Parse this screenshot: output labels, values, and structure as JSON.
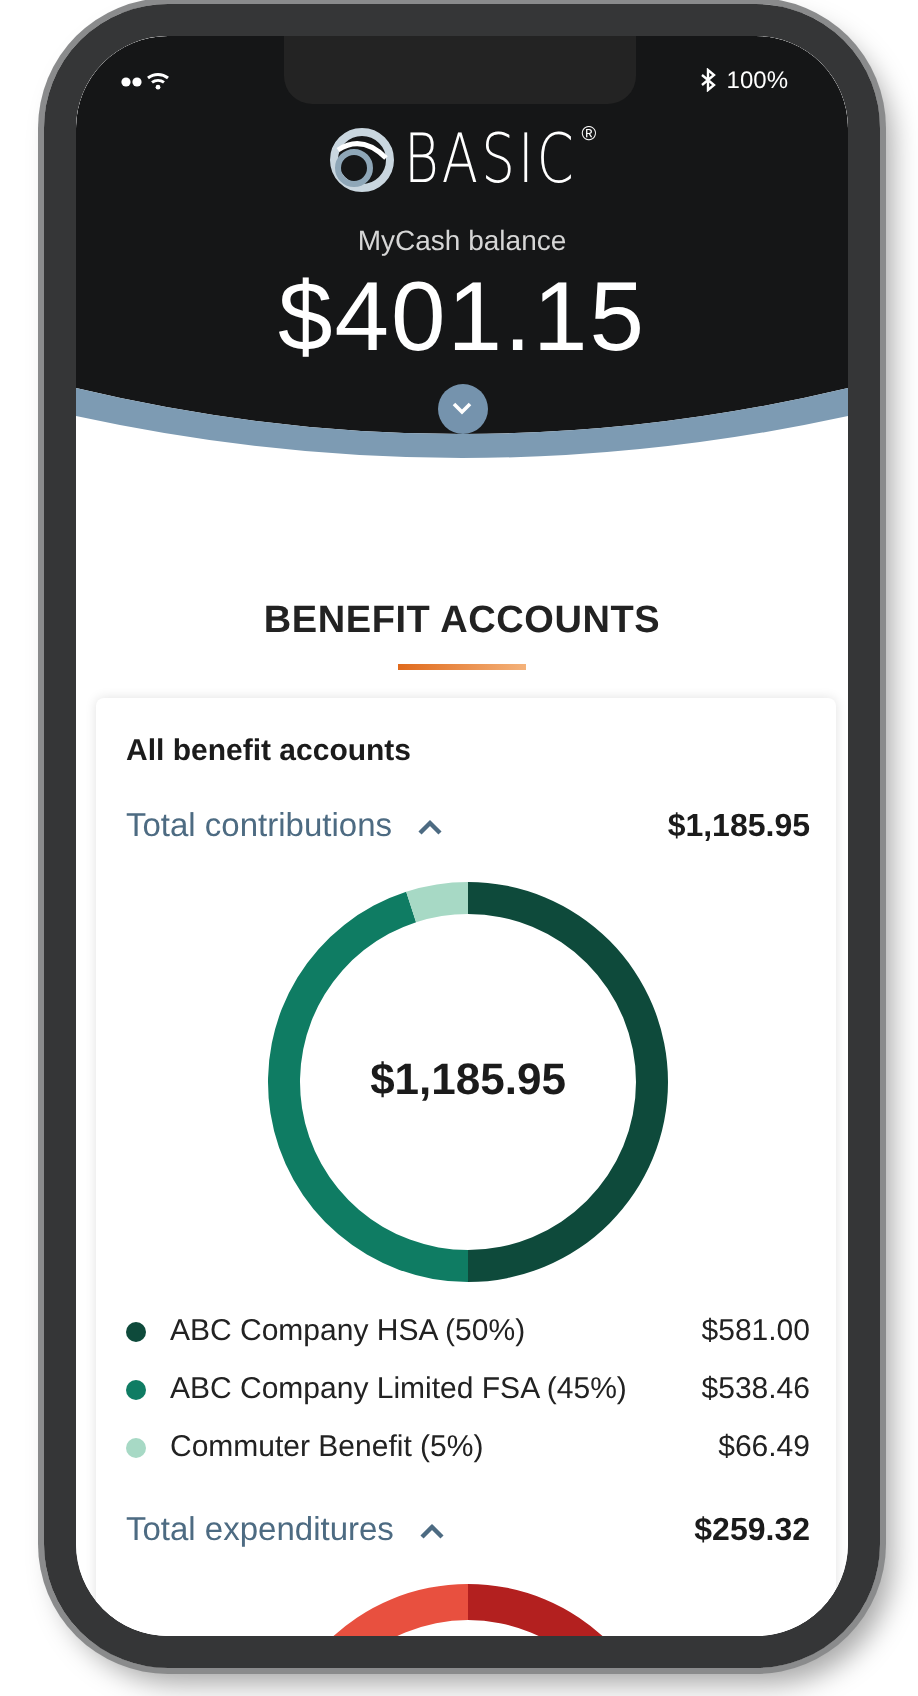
{
  "status_bar": {
    "battery": "100%"
  },
  "header": {
    "logo": "BASIC",
    "logo_mark": "®",
    "balance_label": "MyCash balance",
    "balance": "$401.15"
  },
  "section_title": "BENEFIT ACCOUNTS",
  "card": {
    "title": "All benefit accounts",
    "contributions": {
      "label": "Total contributions",
      "total": "$1,185.95",
      "center_label": "$1,185.95",
      "chart_data": {
        "type": "donut",
        "values": [
          50,
          45,
          5
        ]
      },
      "items": [
        {
          "label": "ABC Company HSA (50%)",
          "amount": "$581.00",
          "color": "#0e4a3b"
        },
        {
          "label": "ABC Company Limited FSA (45%)",
          "amount": "$538.46",
          "color": "#0f7c63"
        },
        {
          "label": "Commuter Benefit (5%)",
          "amount": "$66.49",
          "color": "#a7d9c5"
        }
      ]
    },
    "expenditures": {
      "label": "Total expenditures",
      "total": "$259.32"
    }
  }
}
